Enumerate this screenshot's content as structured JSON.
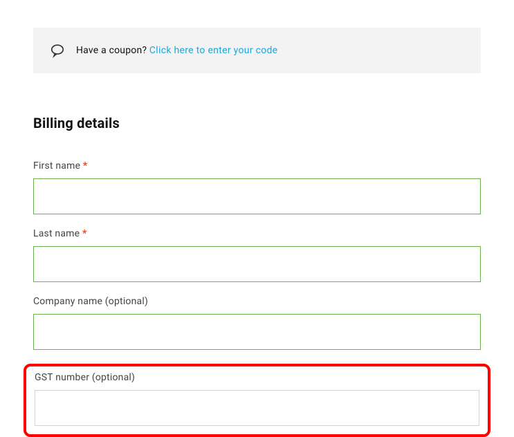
{
  "coupon": {
    "prompt": "Have a coupon?",
    "link_text": "Click here to enter your code"
  },
  "section": {
    "title": "Billing details"
  },
  "fields": {
    "first_name": {
      "label": "First name",
      "required": "*",
      "value": ""
    },
    "last_name": {
      "label": "Last name",
      "required": "*",
      "value": ""
    },
    "company": {
      "label": "Company name (optional)",
      "value": ""
    },
    "gst": {
      "label": "GST number (optional)",
      "value": ""
    }
  }
}
